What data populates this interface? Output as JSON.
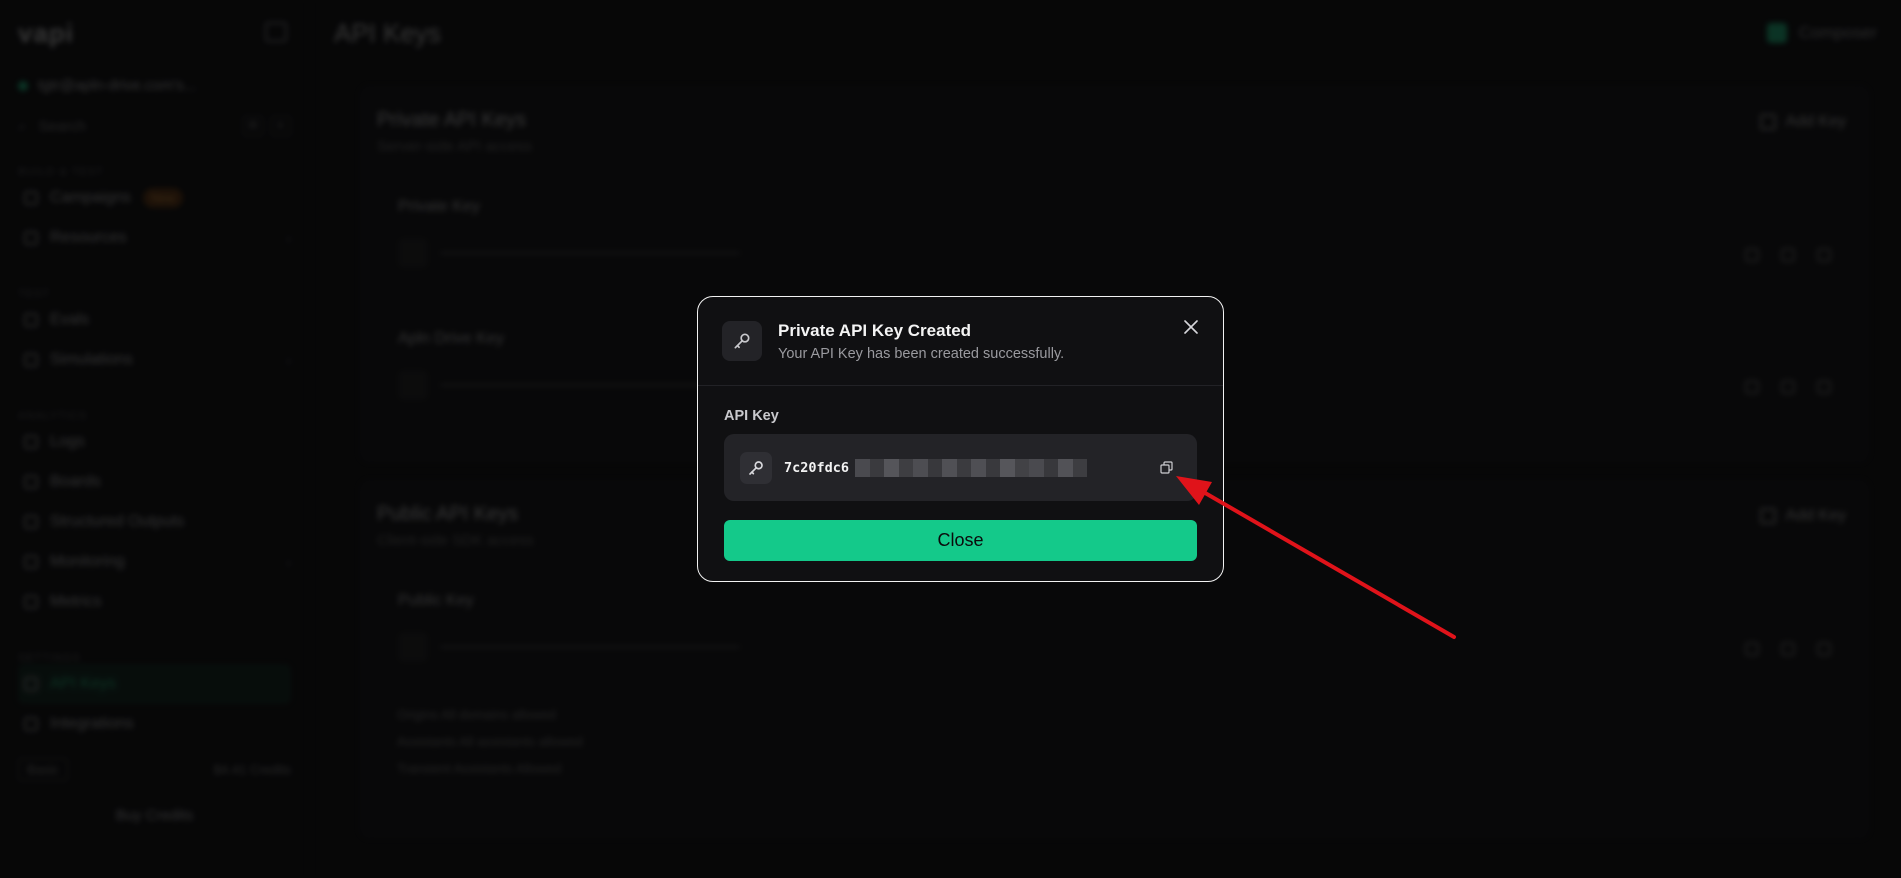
{
  "app": {
    "logo": "vapi",
    "org": "tgtr@apln-drive.com's...",
    "search_placeholder": "Search",
    "kbd": [
      "⌘",
      "K"
    ],
    "sections": [
      {
        "label": "Build & Test",
        "items": [
          {
            "label": "Campaigns",
            "badge": "New"
          },
          {
            "label": "Resources",
            "chev": "›"
          }
        ]
      },
      {
        "label": "Test",
        "items": [
          {
            "label": "Evals"
          },
          {
            "label": "Simulations",
            "chev": "›"
          }
        ]
      },
      {
        "label": "Analytics",
        "items": [
          {
            "label": "Logs"
          },
          {
            "label": "Boards"
          },
          {
            "label": "Structured Outputs"
          },
          {
            "label": "Monitoring",
            "chev": "›"
          },
          {
            "label": "Metrics"
          }
        ]
      },
      {
        "label": "Settings",
        "items": [
          {
            "label": "API Keys",
            "active": true
          },
          {
            "label": "Integrations"
          }
        ]
      }
    ],
    "plan": {
      "chip": "Basic",
      "credits": "$4.41 Credits"
    },
    "buy": "Buy Credits"
  },
  "main": {
    "page_title": "API Keys",
    "composer": "Composer",
    "private_section": {
      "title": "Private API Keys",
      "subtitle": "Server-side API access",
      "add_label": "Add Key",
      "rows": [
        {
          "label": "Private Key"
        },
        {
          "label": "Apln Drive Key"
        }
      ]
    },
    "public_section": {
      "title": "Public API Keys",
      "subtitle": "Client-side SDK access",
      "add_label": "Add Key",
      "rows": [
        {
          "label": "Public Key"
        }
      ],
      "meta": [
        "Origins   All domains allowed",
        "Assistants   All assistants allowed",
        "Transient Assistants   Allowed"
      ]
    }
  },
  "modal": {
    "title": "Private API Key Created",
    "subtitle": "Your API Key has been created successfully.",
    "field_label": "API Key",
    "key_prefix": "7c20fdc6",
    "close_label": "Close",
    "accent": "#14c98a",
    "annotation_color": "#e0131a"
  }
}
